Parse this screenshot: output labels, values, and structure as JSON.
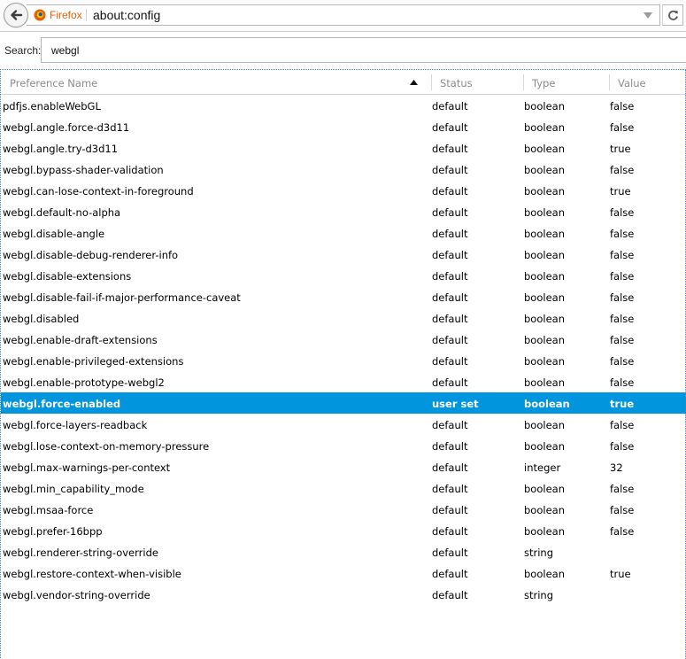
{
  "nav": {
    "identity_label": "Firefox",
    "url": "about:config"
  },
  "search": {
    "label": "Search:",
    "value": "webgl"
  },
  "columns": {
    "name": "Preference Name",
    "status": "Status",
    "type": "Type",
    "value": "Value"
  },
  "colors": {
    "accent": "#0095dd",
    "identity": "#e66000"
  },
  "selected_index": 14,
  "rows": [
    {
      "name": "pdfjs.enableWebGL",
      "status": "default",
      "type": "boolean",
      "value": "false"
    },
    {
      "name": "webgl.angle.force-d3d11",
      "status": "default",
      "type": "boolean",
      "value": "false"
    },
    {
      "name": "webgl.angle.try-d3d11",
      "status": "default",
      "type": "boolean",
      "value": "true"
    },
    {
      "name": "webgl.bypass-shader-validation",
      "status": "default",
      "type": "boolean",
      "value": "false"
    },
    {
      "name": "webgl.can-lose-context-in-foreground",
      "status": "default",
      "type": "boolean",
      "value": "true"
    },
    {
      "name": "webgl.default-no-alpha",
      "status": "default",
      "type": "boolean",
      "value": "false"
    },
    {
      "name": "webgl.disable-angle",
      "status": "default",
      "type": "boolean",
      "value": "false"
    },
    {
      "name": "webgl.disable-debug-renderer-info",
      "status": "default",
      "type": "boolean",
      "value": "false"
    },
    {
      "name": "webgl.disable-extensions",
      "status": "default",
      "type": "boolean",
      "value": "false"
    },
    {
      "name": "webgl.disable-fail-if-major-performance-caveat",
      "status": "default",
      "type": "boolean",
      "value": "false"
    },
    {
      "name": "webgl.disabled",
      "status": "default",
      "type": "boolean",
      "value": "false"
    },
    {
      "name": "webgl.enable-draft-extensions",
      "status": "default",
      "type": "boolean",
      "value": "false"
    },
    {
      "name": "webgl.enable-privileged-extensions",
      "status": "default",
      "type": "boolean",
      "value": "false"
    },
    {
      "name": "webgl.enable-prototype-webgl2",
      "status": "default",
      "type": "boolean",
      "value": "false"
    },
    {
      "name": "webgl.force-enabled",
      "status": "user set",
      "type": "boolean",
      "value": "true"
    },
    {
      "name": "webgl.force-layers-readback",
      "status": "default",
      "type": "boolean",
      "value": "false"
    },
    {
      "name": "webgl.lose-context-on-memory-pressure",
      "status": "default",
      "type": "boolean",
      "value": "false"
    },
    {
      "name": "webgl.max-warnings-per-context",
      "status": "default",
      "type": "integer",
      "value": "32"
    },
    {
      "name": "webgl.min_capability_mode",
      "status": "default",
      "type": "boolean",
      "value": "false"
    },
    {
      "name": "webgl.msaa-force",
      "status": "default",
      "type": "boolean",
      "value": "false"
    },
    {
      "name": "webgl.prefer-16bpp",
      "status": "default",
      "type": "boolean",
      "value": "false"
    },
    {
      "name": "webgl.renderer-string-override",
      "status": "default",
      "type": "string",
      "value": ""
    },
    {
      "name": "webgl.restore-context-when-visible",
      "status": "default",
      "type": "boolean",
      "value": "true"
    },
    {
      "name": "webgl.vendor-string-override",
      "status": "default",
      "type": "string",
      "value": ""
    }
  ]
}
